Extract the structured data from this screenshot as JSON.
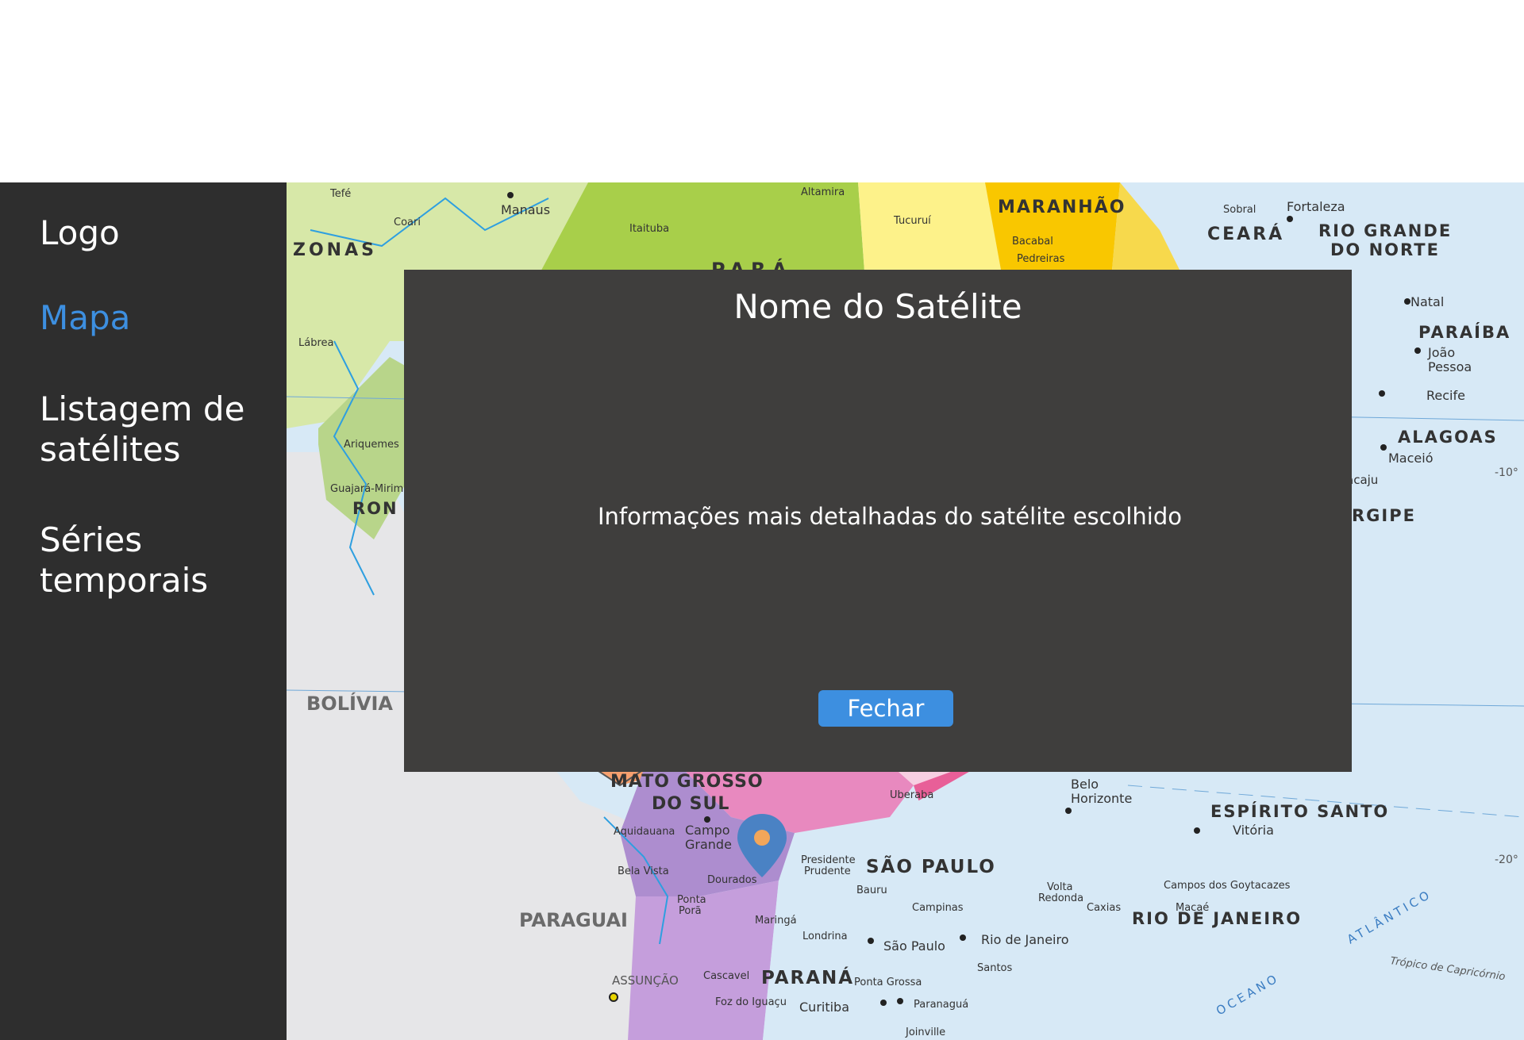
{
  "sidebar": {
    "logo": "Logo",
    "items": [
      {
        "label": "Mapa",
        "active": true
      },
      {
        "label": "Listagem de\nsatélites",
        "active": false
      },
      {
        "label": "Séries\ntemporais",
        "active": false
      }
    ]
  },
  "modal": {
    "title": "Nome do Satélite",
    "body": "Informações mais detalhadas do satélite escolhido",
    "close_label": "Fechar"
  },
  "map": {
    "pin_icon": "map-pin-icon",
    "labels": {
      "zonas": "ZONAS",
      "maranhao": "MARANHÃO",
      "ceara": "CEARÁ",
      "rn": "RIO GRANDE",
      "rn2": "DO NORTE",
      "paraiba": "PARAÍBA",
      "alagoas": "ALAGOAS",
      "sergipe": "RGIPE",
      "bolivia": "BOLÍVIA",
      "paraguai": "PARAGUAI",
      "ms": "MATO GROSSO",
      "ms2": "DO SUL",
      "sp": "SÃO PAULO",
      "parana": "PARANÁ",
      "es": "ESPÍRITO SANTO",
      "rj": "RIO DE JANEIRO",
      "para": "PARÁ",
      "ron": "RON",
      "oceano": "OCEANO",
      "atlantico": "ATLÂNTICO",
      "tropico": "Trópico de Capricórnio",
      "lat10": "-10°",
      "lat20": "-20°",
      "manaus": "Manaus",
      "fortaleza": "Fortaleza",
      "natal": "Natal",
      "recife": "Recife",
      "maceio": "Maceió",
      "joao_pessoa": "João",
      "joao_pessoa2": "Pessoa",
      "campo_grande": "Campo",
      "campo_grande2": "Grande",
      "sao_paulo": "São Paulo",
      "rio": "Rio de Janeiro",
      "curitiba": "Curitiba",
      "belo": "Belo",
      "belo2": "Horizonte",
      "vitoria": "Vitória",
      "assuncao": "ASSUNÇÃO",
      "dourados": "Dourados",
      "londrina": "Londrina",
      "santos": "Santos",
      "campinas": "Campinas",
      "labrea": "Lábrea",
      "tefe": "Tefé",
      "coari": "Coari",
      "altamira": "Altamira",
      "tucurui": "Tucuruí",
      "itaituba": "Itaituba",
      "sobral": "Sobral",
      "bacabal": "Bacabal",
      "pedreiras": "Pedreiras",
      "caxias": "Caxias",
      "foz": "Foz do Iguaçu",
      "cascavel": "Cascavel",
      "maringa": "Maringá",
      "ponta_grossa": "Ponta Grossa",
      "bauru": "Bauru",
      "uberaba": "Uberaba",
      "presidente": "Presidente",
      "presidente2": "Prudente",
      "aquidauana": "Aquidauana",
      "bela_vista": "Bela Vista",
      "ponta_pora": "Ponta",
      "ponta_pora2": "Porã",
      "ariquemes": "Ariquemes",
      "guajara": "Guajará-Mirim",
      "paranagua": "Paranaguá",
      "joinville": "Joinville",
      "campos": "Campos dos Goytacazes",
      "aracaju": "acaju",
      "macae": "Macaé",
      "volta": "Volta",
      "volta2": "Redonda"
    }
  }
}
